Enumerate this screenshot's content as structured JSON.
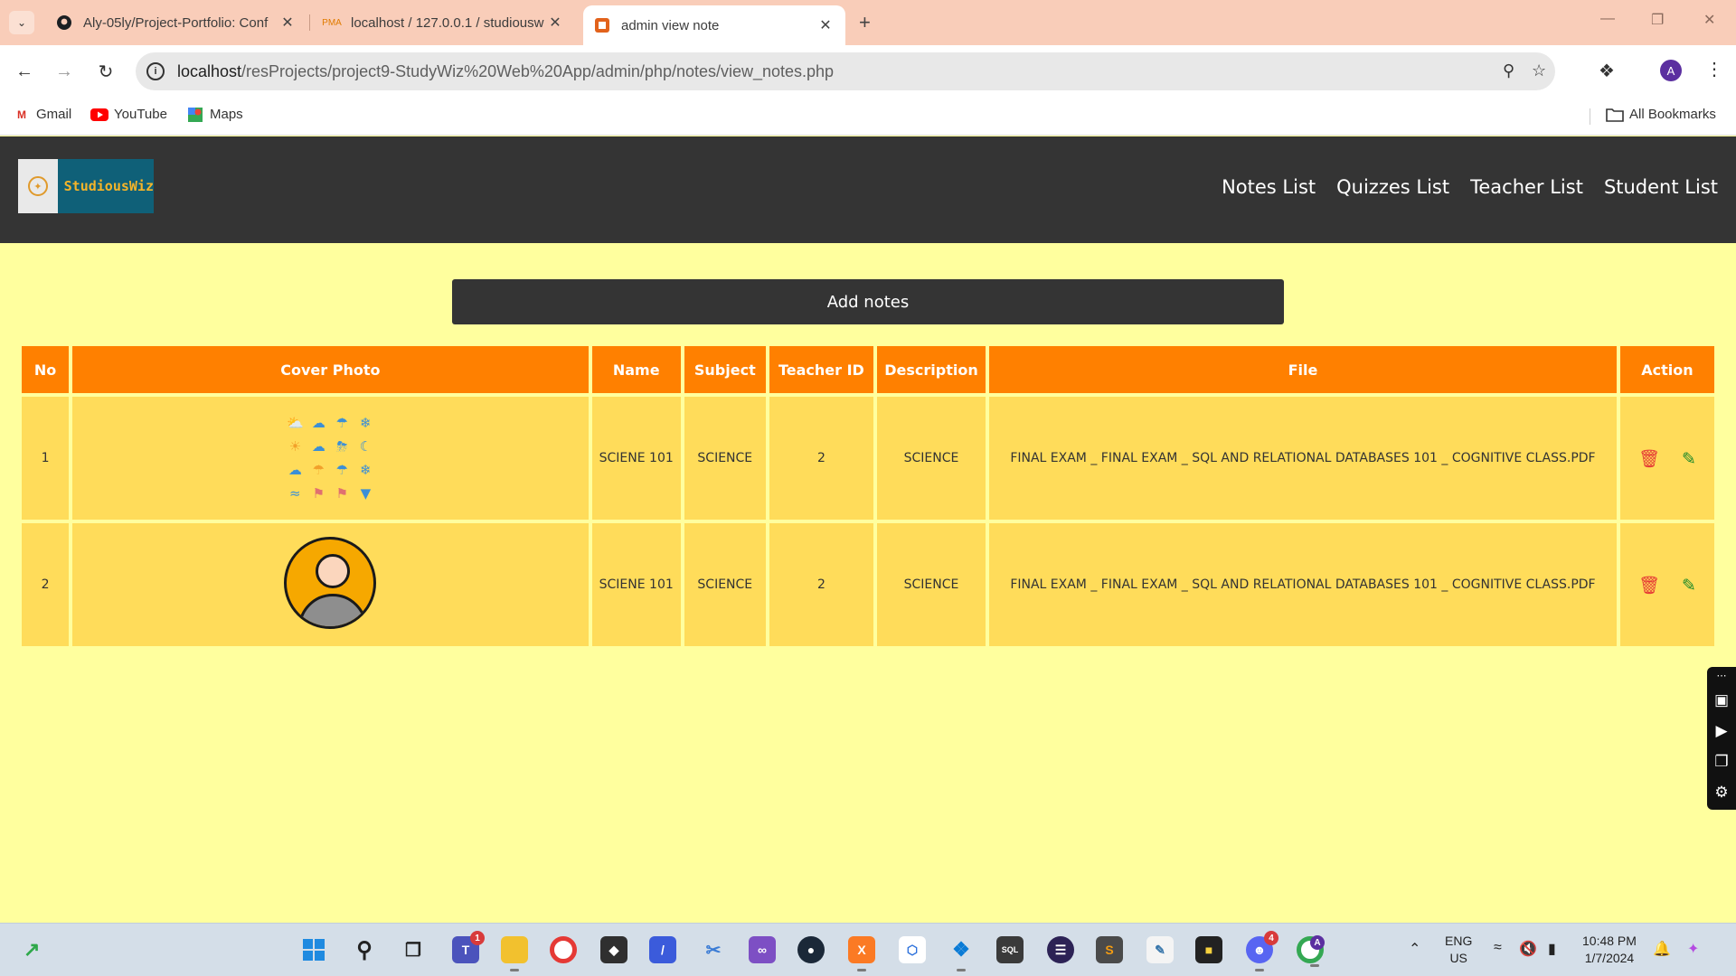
{
  "browser": {
    "tabs": [
      {
        "title": "Aly-05ly/Project-Portfolio: Conf",
        "icon": "github-icon",
        "active": false
      },
      {
        "title": "localhost / 127.0.0.1 / studiousw",
        "icon": "phpmyadmin-icon",
        "active": false
      },
      {
        "title": "admin view note",
        "icon": "studiouswiz-favicon",
        "active": true
      }
    ],
    "url_host": "localhost",
    "url_path": "/resProjects/project9-StudyWiz%20Web%20App/admin/php/notes/view_notes.php",
    "profile_initial": "A",
    "bookmarks": [
      {
        "label": "Gmail",
        "icon": "gmail-icon",
        "color": "#d93025"
      },
      {
        "label": "YouTube",
        "icon": "youtube-icon",
        "color": "#ff0000"
      },
      {
        "label": "Maps",
        "icon": "maps-icon",
        "color": "#34a853"
      }
    ],
    "all_bookmarks": "All Bookmarks"
  },
  "site": {
    "logo_text": "StudiousWiz",
    "nav": [
      "Notes List",
      "Quizzes List",
      "Teacher List",
      "Student List"
    ],
    "add_button": "Add notes",
    "colors": {
      "nav_bg": "#343434",
      "page_bg": "#ffff9e",
      "header_bg": "#ff8000",
      "cell_bg": "#ffdc5a",
      "logo_bg": "#0f6078",
      "logo_text": "#f5b429"
    }
  },
  "table": {
    "headers": [
      "No",
      "Cover Photo",
      "Name",
      "Subject",
      "Teacher ID",
      "Description",
      "File",
      "Action"
    ],
    "rows": [
      {
        "no": "1",
        "cover": "weather-icons-image",
        "name": "SCIENE 101",
        "subject": "SCIENCE",
        "teacher_id": "2",
        "description": "SCIENCE",
        "file": "FINAL EXAM _ FINAL EXAM _ SQL AND RELATIONAL DATABASES 101 _ COGNITIVE CLASS.PDF"
      },
      {
        "no": "2",
        "cover": "user-avatar-image",
        "name": "SCIENE 101",
        "subject": "SCIENCE",
        "teacher_id": "2",
        "description": "SCIENCE",
        "file": "FINAL EXAM _ FINAL EXAM _ SQL AND RELATIONAL DATABASES 101 _ COGNITIVE CLASS.PDF"
      }
    ]
  },
  "taskbar": {
    "lang_line1": "ENG",
    "lang_line2": "US",
    "time": "10:48 PM",
    "date": "1/7/2024",
    "teams_badge": "1",
    "discord_badge": "4",
    "chrome_badge": "A"
  }
}
